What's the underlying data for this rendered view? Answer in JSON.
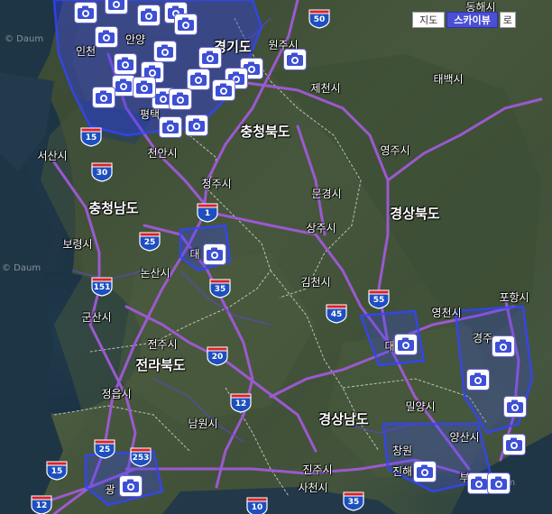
{
  "map_type": {
    "map_label": "지도",
    "skyview_label": "스카이뷰",
    "hybrid_label_partial": "로"
  },
  "watermark": "© Daum",
  "provinces": [
    {
      "id": "gyeonggi",
      "label": "경기도"
    },
    {
      "id": "chungbuk",
      "label": "충청북도"
    },
    {
      "id": "chungnam",
      "label": "충청남도"
    },
    {
      "id": "gyeongbuk",
      "label": "경상북도"
    },
    {
      "id": "jeonbuk",
      "label": "전라북도"
    },
    {
      "id": "gyeongnam",
      "label": "경상남도"
    }
  ],
  "cities": [
    {
      "id": "incheon",
      "label": "인천"
    },
    {
      "id": "wonju",
      "label": "원주시"
    },
    {
      "id": "taebaek",
      "label": "태백시"
    },
    {
      "id": "jecheon",
      "label": "제천시"
    },
    {
      "id": "seosan",
      "label": "서산시"
    },
    {
      "id": "cheonan",
      "label": "천안시"
    },
    {
      "id": "yeongju",
      "label": "영주시"
    },
    {
      "id": "cheongju",
      "label": "청주시"
    },
    {
      "id": "mungyeong",
      "label": "문경시"
    },
    {
      "id": "sangju",
      "label": "상주시"
    },
    {
      "id": "boryeong",
      "label": "보령시"
    },
    {
      "id": "nonsan",
      "label": "논산시"
    },
    {
      "id": "gimcheon",
      "label": "김천시"
    },
    {
      "id": "pohang",
      "label": "포항시"
    },
    {
      "id": "gunsan",
      "label": "군산시"
    },
    {
      "id": "yeongcheon",
      "label": "영천시"
    },
    {
      "id": "jeonju",
      "label": "전주시"
    },
    {
      "id": "jeongeup",
      "label": "정읍시"
    },
    {
      "id": "miryang",
      "label": "밀양시"
    },
    {
      "id": "namwon",
      "label": "남원시"
    },
    {
      "id": "yangsan",
      "label": "양산시"
    },
    {
      "id": "jinju",
      "label": "진주시"
    },
    {
      "id": "sacheon",
      "label": "사천시"
    },
    {
      "id": "donghae",
      "label": "동해시"
    },
    {
      "id": "pyeongtaek",
      "label": "평택"
    },
    {
      "id": "daejeon",
      "label": "대"
    },
    {
      "id": "daegu",
      "label": "대"
    },
    {
      "id": "gwangju",
      "label": "광"
    },
    {
      "id": "changwon",
      "label": "창원"
    },
    {
      "id": "jinhae",
      "label": "진해"
    },
    {
      "id": "busan",
      "label": "부"
    },
    {
      "id": "gyeongju",
      "label": "경주"
    },
    {
      "id": "anyang",
      "label": "안양"
    }
  ],
  "highways": [
    "50",
    "15",
    "30",
    "1",
    "25",
    "35",
    "151",
    "55",
    "45",
    "20",
    "12",
    "15",
    "253",
    "12",
    "10",
    "35",
    "25"
  ],
  "camera_icon_count": 32
}
